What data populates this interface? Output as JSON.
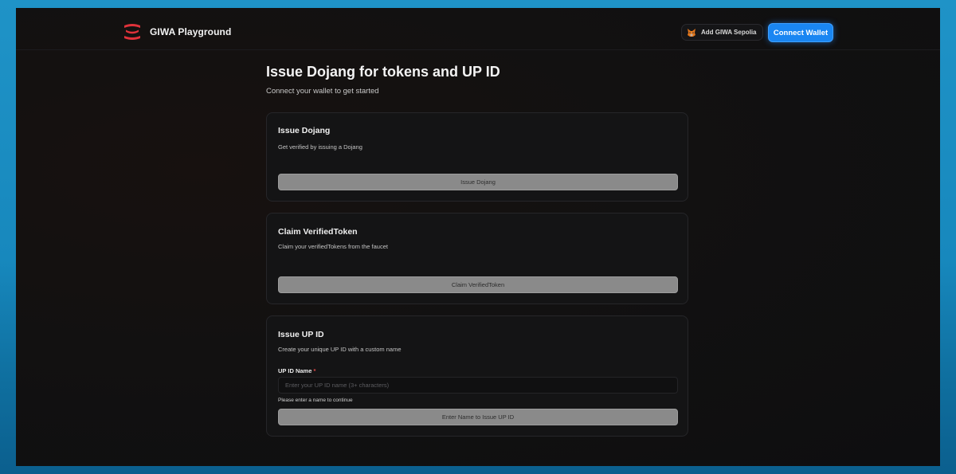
{
  "app": {
    "name": "GIWA Playground"
  },
  "header": {
    "add_network_label": "Add GIWA Sepolia",
    "connect_label": "Connect Wallet"
  },
  "page": {
    "title": "Issue Dojang for tokens and UP ID",
    "subtitle": "Connect your wallet to get started"
  },
  "cards": {
    "dojang": {
      "title": "Issue Dojang",
      "description": "Get verified by issuing a Dojang",
      "button": "Issue Dojang"
    },
    "token": {
      "title": "Claim VerifiedToken",
      "description": "Claim your verifiedTokens from the faucet",
      "button": "Claim VerifiedToken"
    },
    "upid": {
      "title": "Issue UP ID",
      "description": "Create your unique UP ID with a custom name",
      "field_label": "UP ID Name",
      "required_mark": "*",
      "placeholder": "Enter your UP ID name (3+ characters)",
      "value": "",
      "helper": "Please enter a name to continue",
      "button": "Enter Name to Issue UP ID"
    }
  },
  "icons": {
    "logo": "giwa-logo-icon",
    "wallet": "metamask-fox-icon"
  },
  "colors": {
    "accent": "#1a86f2",
    "logo_red": "#e0323a",
    "disabled_button": "#8a8a8a"
  }
}
